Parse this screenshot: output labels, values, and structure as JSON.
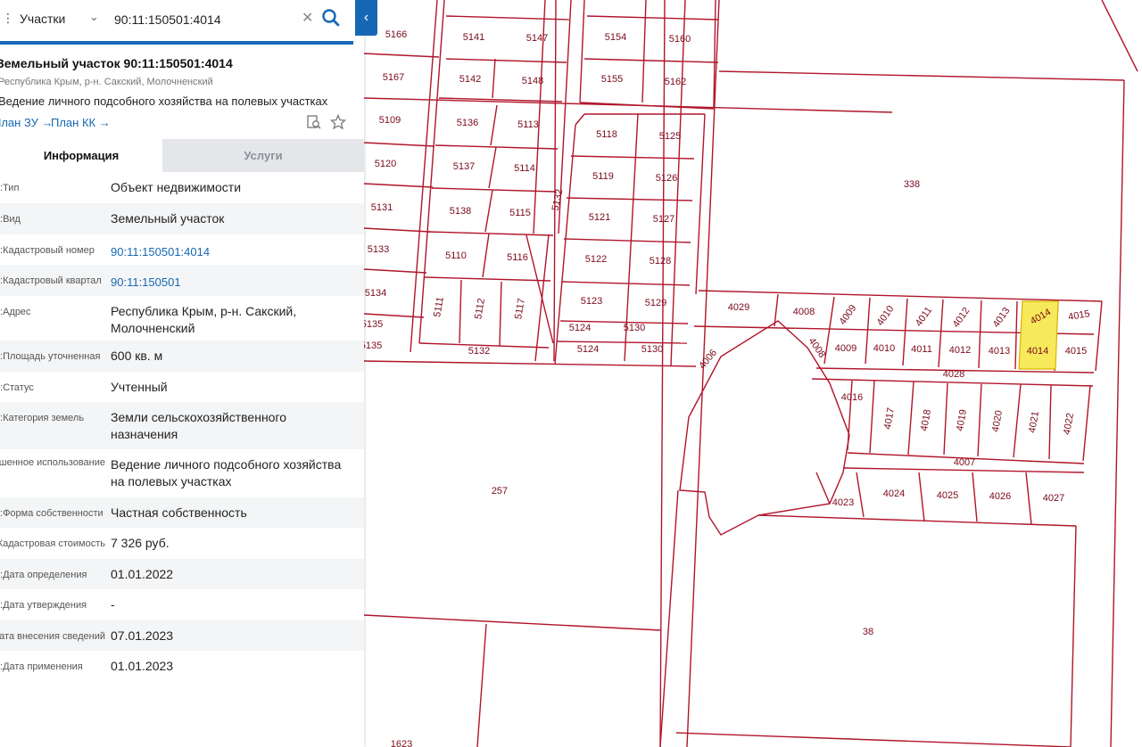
{
  "search": {
    "category": "Участки",
    "query": "90:11:150501:4014"
  },
  "header": {
    "title": "Земельный участок 90:11:150501:4014",
    "address": "Республика Крым, р-н. Сакский, Молочненский",
    "usage": "Ведение личного подсобного хозяйства на полевых участках",
    "plan_zu": "План ЗУ",
    "plan_kk": "План КК"
  },
  "tabs": {
    "info": "Информация",
    "services": "Услуги"
  },
  "info_rows": [
    {
      "label": "Тип:",
      "value": "Объект недвижимости",
      "link": false
    },
    {
      "label": "Вид:",
      "value": "Земельный участок",
      "link": false
    },
    {
      "label": "Кадастровый номер:",
      "value": "90:11:150501:4014",
      "link": true
    },
    {
      "label": "Кадастровый квартал:",
      "value": "90:11:150501",
      "link": true
    },
    {
      "label": "Адрес:",
      "value": "Республика Крым, р-н. Сакский, Молочненский",
      "link": false
    },
    {
      "label": "Площадь уточненная:",
      "value": "600 кв. м",
      "link": false
    },
    {
      "label": "Статус:",
      "value": "Учтенный",
      "link": false
    },
    {
      "label": "Категория земель:",
      "value": "Земли сельскохозяйственного назначения",
      "link": false
    },
    {
      "label": "Разрешенное использование:",
      "value": "Ведение личного подсобного хозяйства на полевых участках",
      "link": false
    },
    {
      "label": "Форма собственности:",
      "value": "Частная собственность",
      "link": false
    },
    {
      "label": "Кадастровая стоимость:",
      "value": "7 326 руб.",
      "link": false
    },
    {
      "label": "Дата определения:",
      "value": "01.01.2022",
      "link": false
    },
    {
      "label": "Дата утверждения:",
      "value": "-",
      "link": false
    },
    {
      "label": "Дата внесения сведений:",
      "value": "07.01.2023",
      "link": false
    },
    {
      "label": "Дата применения:",
      "value": "01.01.2023",
      "link": false
    }
  ],
  "map": {
    "parcel_line_color": "#b0152a",
    "highlight_color": "#f7ea5a",
    "labels": [
      "5166",
      "5141",
      "5147",
      "5154",
      "5160",
      "5167",
      "5142",
      "5148",
      "5155",
      "5162",
      "5109",
      "5136",
      "5113",
      "5118",
      "5125",
      "5120",
      "5137",
      "5114",
      "5119",
      "5126",
      "338",
      "5131",
      "5138",
      "5115",
      "5132",
      "5121",
      "5127",
      "5133",
      "5110",
      "5116",
      "5122",
      "5128",
      "5134",
      "5111",
      "5112",
      "5117",
      "5123",
      "5129",
      "5135",
      "5124",
      "5130",
      "5135",
      "5132",
      "5124",
      "5130",
      "4029",
      "4008",
      "4009",
      "4010",
      "4011",
      "4012",
      "4013",
      "4014",
      "4015",
      "4006",
      "4008",
      "4009",
      "4010",
      "4011",
      "4012",
      "4013",
      "4014",
      "4015",
      "4028",
      "4016",
      "4017",
      "4018",
      "4019",
      "4020",
      "4021",
      "4022",
      "4007",
      "257",
      "4023",
      "4024",
      "4025",
      "4026",
      "4027",
      "38",
      "1623"
    ]
  }
}
